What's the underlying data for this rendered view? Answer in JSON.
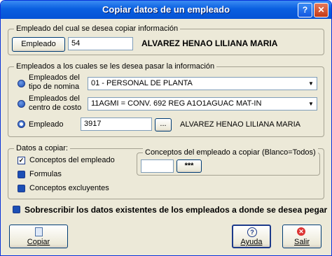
{
  "window": {
    "title": "Copiar datos de un empleado",
    "help_glyph": "?",
    "close_glyph": "✕"
  },
  "source": {
    "legend": "Empleado del cual se desea copiar información",
    "button_label": "Empleado",
    "employee_id": "54",
    "employee_name": "ALVAREZ HENAO LILIANA MARIA"
  },
  "targets": {
    "legend": "Empleados a los cuales se les desea pasar la información",
    "option_tipo_label_1": "Empleados del",
    "option_tipo_label_2": "tipo de nomina",
    "tipo_nomina_value": "01 - PERSONAL DE PLANTA",
    "option_centro_label_1": "Empleados del",
    "option_centro_label_2": "centro de costo",
    "centro_costo_value": "11AGMI = CONV. 692 REG A1O1AGUAC MAT-IN",
    "option_empleado_label": "Empleado",
    "employee_id": "3917",
    "browse_label": "...",
    "employee_name": "ALVAREZ HENAO LILIANA MARIA"
  },
  "copy_data": {
    "legend": "Datos a copiar:",
    "conceptos_label": "Conceptos del empleado",
    "formulas_label": "Formulas",
    "excluyentes_label": "Conceptos excluyentes",
    "conceptos_group_legend": "Conceptos del empleado a copiar (Blanco=Todos)",
    "conceptos_value": "",
    "conceptos_button": "***"
  },
  "overwrite_label": "Sobrescribir los datos existentes de los empleados a donde se desea pegar",
  "buttons": {
    "copiar": "Copiar",
    "ayuda": "Ayuda",
    "salir": "Salir"
  },
  "colors": {
    "title_bar": "#0a5fe0",
    "window_bg": "#ece9d8",
    "radio": "#1c4fb5"
  }
}
